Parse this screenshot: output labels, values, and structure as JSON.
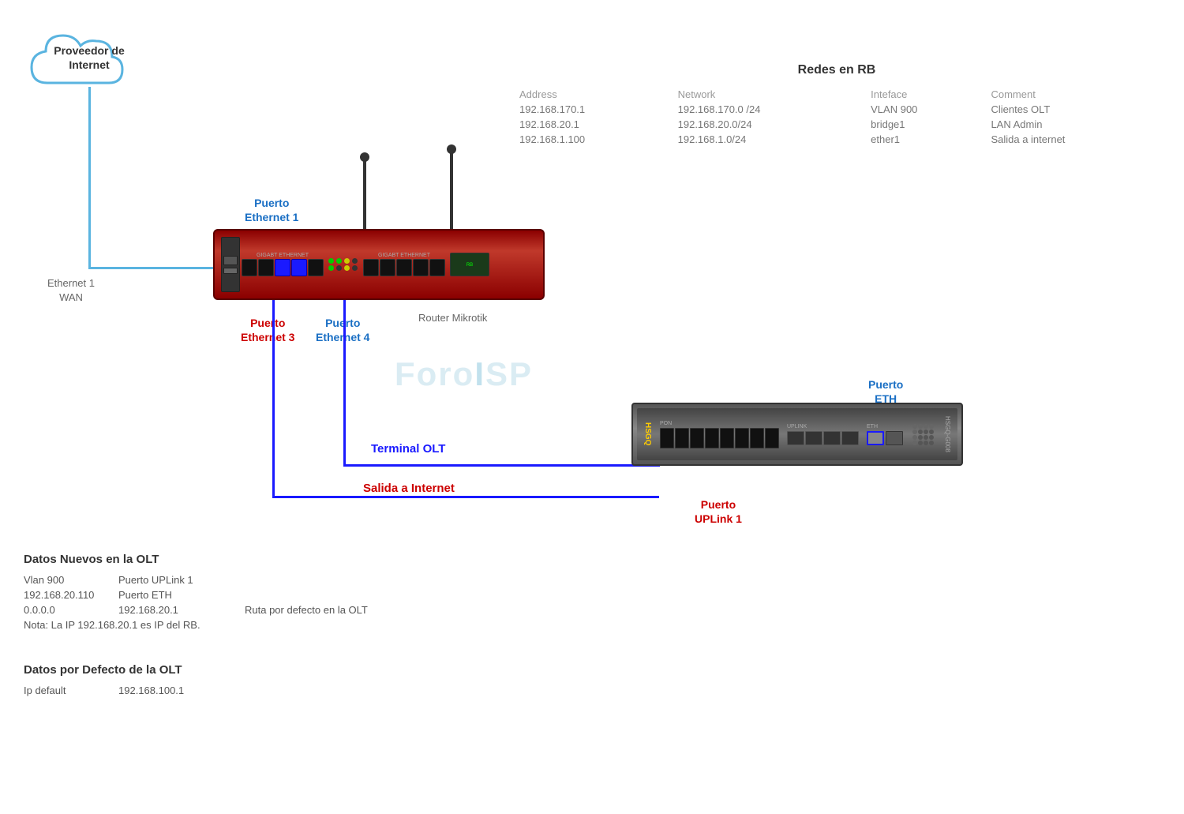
{
  "cloud": {
    "label_line1": "Proveedor de",
    "label_line2": "Internet"
  },
  "labels": {
    "eth1_wan": "Ethernet 1\nWAN",
    "eth1_port": "Puerto\nEthernet 1",
    "eth3_port": "Puerto\nEthernet 3",
    "eth4_port": "Puerto\nEthernet 4",
    "router_mikrotik": "Router Mikrotik",
    "terminal_olt": "Terminal OLT",
    "salida_internet": "Salida a Internet",
    "puerto_eth": "Puerto\nETH",
    "puerto_uplink": "Puerto\nUPLink 1",
    "watermark": "ForoISP"
  },
  "redes_rb": {
    "title": "Redes en RB",
    "headers": [
      "Address",
      "Network",
      "Inteface",
      "Comment"
    ],
    "rows": [
      [
        "192.168.170.1",
        "192.168.170.0 /24",
        "VLAN 900",
        "Clientes OLT"
      ],
      [
        "192.168.20.1",
        "192.168.20.0/24",
        "bridge1",
        "LAN Admin"
      ],
      [
        "192.168.1.100",
        "192.168.1.0/24",
        "ether1",
        "Salida a internet"
      ]
    ]
  },
  "datos_nuevos": {
    "title": "Datos Nuevos en  la OLT",
    "rows": [
      {
        "col1": "Vlan 900",
        "col2": "Puerto UPLink 1",
        "col3": ""
      },
      {
        "col1": "192.168.20.110",
        "col2": "Puerto ETH",
        "col3": ""
      },
      {
        "col1": "0.0.0.0",
        "col2": "192.168.20.1",
        "col3": "Ruta  por defecto en la OLT"
      }
    ],
    "note": "Nota: La IP 192.168.20.1 es IP del RB."
  },
  "datos_defecto": {
    "title": "Datos por Defecto de la OLT",
    "rows": [
      {
        "col1": "Ip default",
        "col2": "192.168.100.1"
      }
    ]
  }
}
